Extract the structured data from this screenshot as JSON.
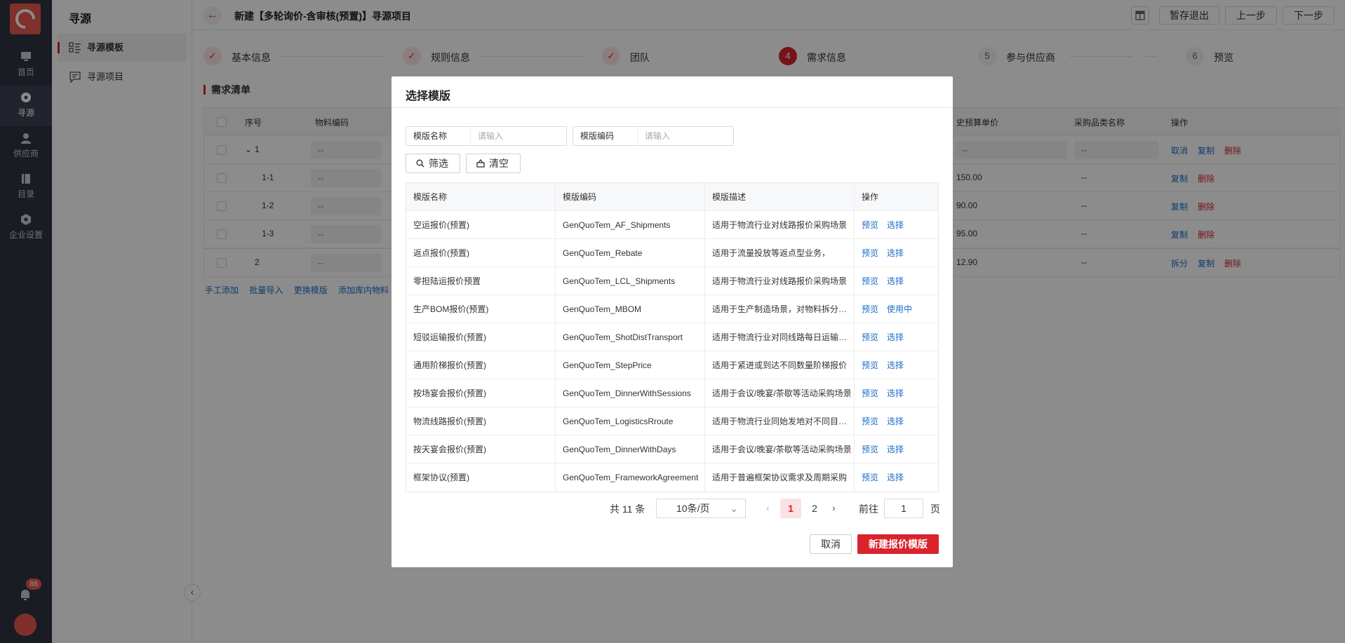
{
  "rail": {
    "items": [
      {
        "label": "首页"
      },
      {
        "label": "寻源"
      },
      {
        "label": "供应商"
      },
      {
        "label": "目录"
      },
      {
        "label": "企业设置"
      }
    ],
    "notification_count": "86"
  },
  "subnav": {
    "title": "寻源",
    "items": [
      {
        "label": "寻源模板"
      },
      {
        "label": "寻源项目"
      }
    ]
  },
  "topbar": {
    "title": "新建【多轮询价-含审核(预置)】寻源项目",
    "save_exit": "暂存退出",
    "prev": "上一步",
    "next": "下一步"
  },
  "steps": [
    {
      "num": "✓",
      "label": "基本信息"
    },
    {
      "num": "✓",
      "label": "规则信息"
    },
    {
      "num": "✓",
      "label": "团队"
    },
    {
      "num": "4",
      "label": "需求信息"
    },
    {
      "num": "5",
      "label": "参与供应商"
    },
    {
      "num": "6",
      "label": "预览"
    }
  ],
  "demand": {
    "title": "需求清单",
    "columns": {
      "seq": "序号",
      "code": "物料编码",
      "price": "史预算单价",
      "category": "采购品类名称",
      "ops": "操作"
    },
    "rows": [
      {
        "seq": "1",
        "code": "--",
        "price": "--",
        "category": "--",
        "ops": [
          "取消",
          "复制",
          "删除"
        ]
      },
      {
        "seq": "1-1",
        "code": "--",
        "price": "150.00",
        "category": "--",
        "ops": [
          "复制",
          "删除"
        ]
      },
      {
        "seq": "1-2",
        "code": "--",
        "price": "90.00",
        "category": "--",
        "ops": [
          "复制",
          "删除"
        ]
      },
      {
        "seq": "1-3",
        "code": "--",
        "price": "95.00",
        "category": "--",
        "ops": [
          "复制",
          "删除"
        ]
      },
      {
        "seq": "2",
        "code": "--",
        "price": "12.90",
        "category": "--",
        "ops": [
          "拆分",
          "复制",
          "删除"
        ]
      }
    ],
    "links": [
      "手工添加",
      "批量导入",
      "更换模版",
      "添加库内物料"
    ]
  },
  "modal": {
    "title": "选择模版",
    "filters": {
      "name_label": "模版名称",
      "name_placeholder": "请输入",
      "code_label": "模版编码",
      "code_placeholder": "请输入"
    },
    "filter_btn": "筛选",
    "clear_btn": "清空",
    "columns": {
      "name": "模版名称",
      "code": "模版编码",
      "desc": "模版描述",
      "ops": "操作"
    },
    "rows": [
      {
        "name": "空运报价(预置)",
        "code": "GenQuoTem_AF_Shipments",
        "desc": "适用于物流行业对线路报价采购场景",
        "ops": [
          "预览",
          "选择"
        ]
      },
      {
        "name": "返点报价(预置)",
        "code": "GenQuoTem_Rebate",
        "desc": "适用于流量投放等返点型业务，",
        "ops": [
          "预览",
          "选择"
        ]
      },
      {
        "name": "零担陆运报价预置",
        "code": "GenQuoTem_LCL_Shipments",
        "desc": "适用于物流行业对线路报价采购场景",
        "ops": [
          "预览",
          "选择"
        ]
      },
      {
        "name": "生产BOM报价(预置)",
        "code": "GenQuoTem_MBOM",
        "desc": "适用于生产制造场景，对物料拆分报价",
        "ops": [
          "预览",
          "使用中"
        ]
      },
      {
        "name": "短驳运输报价(预置)",
        "code": "GenQuoTem_ShotDistTransport",
        "desc": "适用于物流行业对同线路每日运输报价",
        "ops": [
          "预览",
          "选择"
        ]
      },
      {
        "name": "通用阶梯报价(预置)",
        "code": "GenQuoTem_StepPrice",
        "desc": "适用于紧进或到达不同数量阶梯报价",
        "ops": [
          "预览",
          "选择"
        ]
      },
      {
        "name": "按场宴会报价(预置)",
        "code": "GenQuoTem_DinnerWithSessions",
        "desc": "适用于会议/晚宴/茶歇等活动采购场景",
        "ops": [
          "预览",
          "选择"
        ]
      },
      {
        "name": "物流线路报价(预置)",
        "code": "GenQuoTem_LogisticsRroute",
        "desc": "适用于物流行业同始发地对不同目的地",
        "ops": [
          "预览",
          "选择"
        ]
      },
      {
        "name": "按天宴会报价(预置)",
        "code": "GenQuoTem_DinnerWithDays",
        "desc": "适用于会议/晚宴/茶歇等活动采购场景",
        "ops": [
          "预览",
          "选择"
        ]
      },
      {
        "name": "框架协议(预置)",
        "code": "GenQuoTem_FrameworkAgreement",
        "desc": "适用于普遍框架协议需求及周期采购",
        "ops": [
          "预览",
          "选择"
        ]
      }
    ],
    "pager": {
      "total": "共 11 条",
      "page_size": "10条/页",
      "pages": [
        "1",
        "2"
      ],
      "goto_label": "前往",
      "goto_value": "1",
      "unit": "页"
    },
    "cancel": "取消",
    "create": "新建报价模版"
  },
  "colors": {
    "accent": "#d9232d",
    "link": "#1a6dc8",
    "rail": "#2f3441"
  }
}
